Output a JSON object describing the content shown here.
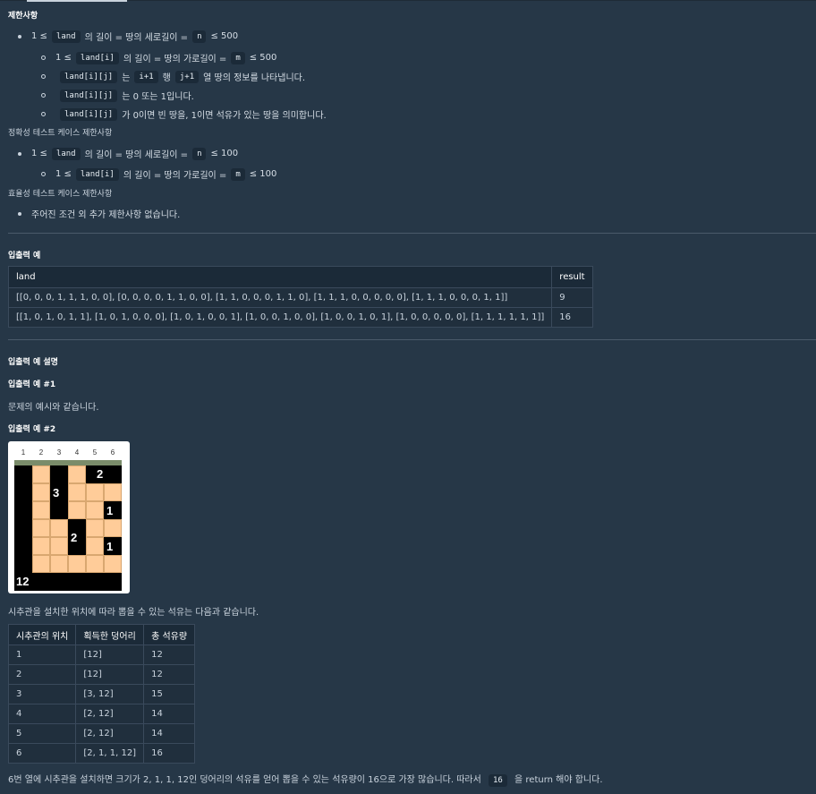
{
  "constraints": {
    "heading": "제한사항",
    "items": [
      {
        "parts": [
          "1 ≤ ",
          "land",
          " 의 길이 = 땅의 세로길이 = ",
          "n",
          " ≤ 500"
        ]
      },
      {
        "parts": [
          "1 ≤ ",
          "land[i]",
          " 의 길이 = 땅의 가로길이 = ",
          "m",
          " ≤ 500"
        ]
      },
      {
        "parts": [
          "",
          "land[i][j]",
          " 는 ",
          "i+1",
          " 행 ",
          "j+1",
          " 열 땅의 정보를 나타냅니다."
        ]
      },
      {
        "parts": [
          "",
          "land[i][j]",
          " 는 0 또는 1입니다."
        ]
      },
      {
        "parts": [
          "",
          "land[i][j]",
          " 가 0이면 빈 땅을, 1이면 석유가 있는 땅을 의미합니다."
        ]
      }
    ],
    "accuracy_heading": "정확성 테스트 케이스 제한사항",
    "accuracy_items": [
      {
        "parts": [
          "1 ≤ ",
          "land",
          " 의 길이 = 땅의 세로길이 = ",
          "n",
          " ≤ 100"
        ]
      },
      {
        "parts": [
          "1 ≤ ",
          "land[i]",
          " 의 길이 = 땅의 가로길이 = ",
          "m",
          " ≤ 100"
        ]
      }
    ],
    "efficiency_heading": "효율성 테스트 케이스 제한사항",
    "efficiency_items": [
      "주어진 조건 외 추가 제한사항 없습니다."
    ]
  },
  "io_example": {
    "heading": "입출력 예",
    "columns": [
      "land",
      "result"
    ],
    "rows": [
      [
        "[[0, 0, 0, 1, 1, 1, 0, 0], [0, 0, 0, 0, 1, 1, 0, 0], [1, 1, 0, 0, 0, 1, 1, 0], [1, 1, 1, 0, 0, 0, 0, 0], [1, 1, 1, 0, 0, 0, 1, 1]]",
        "9"
      ],
      [
        "[[1, 0, 1, 0, 1, 1], [1, 0, 1, 0, 0, 0], [1, 0, 1, 0, 0, 1], [1, 0, 0, 1, 0, 0], [1, 0, 0, 1, 0, 1], [1, 0, 0, 0, 0, 0], [1, 1, 1, 1, 1, 1]]",
        "16"
      ]
    ]
  },
  "explanation": {
    "heading": "입출력 예 설명",
    "ex1_heading": "입출력 예 #1",
    "ex1_text": "문제의 예시와 같습니다.",
    "ex2_heading": "입출력 예 #2",
    "grid_columns": [
      "1",
      "2",
      "3",
      "4",
      "5",
      "6"
    ],
    "grid": [
      [
        1,
        0,
        1,
        0,
        1,
        1
      ],
      [
        1,
        0,
        1,
        0,
        0,
        0
      ],
      [
        1,
        0,
        1,
        0,
        0,
        1
      ],
      [
        1,
        0,
        0,
        1,
        0,
        0
      ],
      [
        1,
        0,
        0,
        1,
        0,
        1
      ],
      [
        1,
        0,
        0,
        0,
        0,
        0
      ],
      [
        1,
        1,
        1,
        1,
        1,
        1
      ]
    ],
    "grid_labels": [
      "2",
      "3",
      "1",
      "2",
      "1",
      "12"
    ],
    "grid_colors": {
      "oil": "#000000",
      "empty": "#ffcc99",
      "surface": "#7a8c6a"
    },
    "ex2_text": "시추관을 설치한 위치에 따라 뽑을 수 있는 석유는 다음과 같습니다.",
    "table_columns": [
      "시추관의 위치",
      "획득한 덩어리",
      "총 석유량"
    ],
    "table_rows": [
      [
        "1",
        "[12]",
        "12"
      ],
      [
        "2",
        "[12]",
        "12"
      ],
      [
        "3",
        "[3, 12]",
        "15"
      ],
      [
        "4",
        "[2, 12]",
        "14"
      ],
      [
        "5",
        "[2, 12]",
        "14"
      ],
      [
        "6",
        "[2, 1, 1, 12]",
        "16"
      ]
    ],
    "final_text_before": "6번 열에 시추관을 설치하면 크기가 2, 1, 1, 12인 덩어리의 석유를 얻어 뽑을 수 있는 석유량이 16으로 가장 많습니다. 따라서 ",
    "final_code": "16",
    "final_text_after": " 을 return 해야 합니다."
  }
}
